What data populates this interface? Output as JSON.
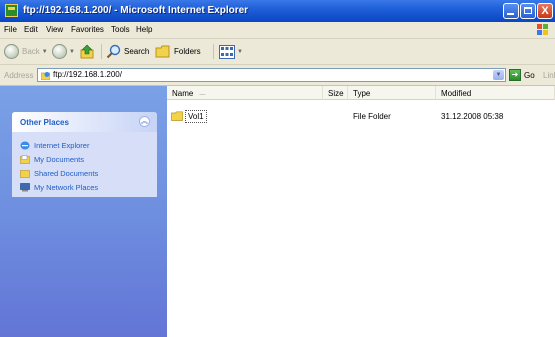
{
  "window": {
    "title": "ftp://192.168.1.200/ - Microsoft Internet Explorer",
    "buttons": {
      "minimize_icon": "minimize-icon",
      "maximize_icon": "maximize-icon",
      "close_label": "X"
    }
  },
  "menu": [
    "File",
    "Edit",
    "View",
    "Favorites",
    "Tools",
    "Help"
  ],
  "toolbar": {
    "back_label": "Back",
    "search_label": "Search",
    "folders_label": "Folders"
  },
  "address": {
    "label": "Address",
    "value": "ftp://192.168.1.200/",
    "go_label": "Go",
    "links_label": "Links"
  },
  "other_places": {
    "title": "Other Places",
    "items": [
      {
        "label": "Internet Explorer",
        "icon": "internet-explorer-icon"
      },
      {
        "label": "My Documents",
        "icon": "my-documents-icon"
      },
      {
        "label": "Shared Documents",
        "icon": "shared-documents-icon"
      },
      {
        "label": "My Network Places",
        "icon": "network-places-icon"
      }
    ]
  },
  "file_list": {
    "columns": [
      "Name",
      "Size",
      "Type",
      "Modified"
    ],
    "rows": [
      {
        "name": "Vol1",
        "size": "",
        "type": "File Folder",
        "modified": "31.12.2008 05:38"
      }
    ]
  },
  "colors": {
    "titlebar": "#0a46c4",
    "chrome": "#ece9d8",
    "left_pane": "#6e8fdf",
    "link_text": "#215dc6"
  }
}
